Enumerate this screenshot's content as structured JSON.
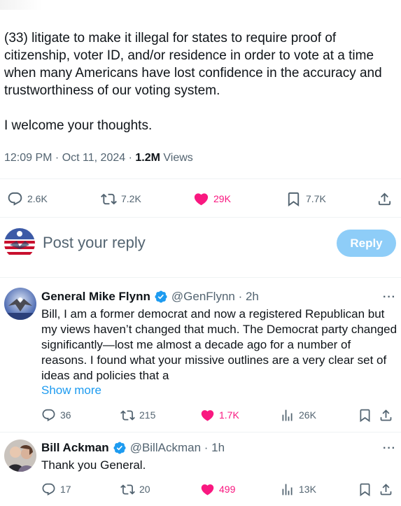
{
  "main_tweet": {
    "text": "(33) litigate to make it illegal for states to require proof of citizenship, voter ID, and/or residence in order to vote at a time when many Americans have lost confidence in the accuracy and trustworthiness of our voting system.\n\nI welcome your thoughts.",
    "time": "12:09 PM · Oct 11, 2024 · ",
    "views_count": "1.2M",
    "views_label": " Views",
    "replies": "2.6K",
    "reposts": "7.2K",
    "likes": "29K",
    "bookmarks": "7.7K"
  },
  "composer": {
    "placeholder": "Post your reply",
    "button_label": "Reply"
  },
  "replies": [
    {
      "name": "General Mike Flynn",
      "handle": "@GenFlynn · 2h",
      "text": "Bill, I am a former democrat and now a registered Republican but my views haven’t changed that much. The Democrat party changed significantly—lost me almost a decade ago for a number of reasons. I found what your missive outlines are a very clear set of ideas and policies that a",
      "show_more": "Show more",
      "replies": "36",
      "reposts": "215",
      "likes": "1.7K",
      "views": "26K"
    },
    {
      "name": "Bill Ackman",
      "handle": "@BillAckman · 1h",
      "text": "Thank you General.",
      "replies": "17",
      "reposts": "20",
      "likes": "499",
      "views": "13K"
    }
  ],
  "more_label": "···",
  "icons": {
    "reply": "reply-icon",
    "repost": "repost-icon",
    "like": "heart-icon",
    "bookmark": "bookmark-icon",
    "share": "share-icon",
    "views": "views-icon",
    "verified": "verified-badge-icon"
  },
  "colors": {
    "accent": "#1d9bf0",
    "like": "#f91880",
    "secondary_text": "#536471",
    "reply_button": "#8ecdf8"
  }
}
